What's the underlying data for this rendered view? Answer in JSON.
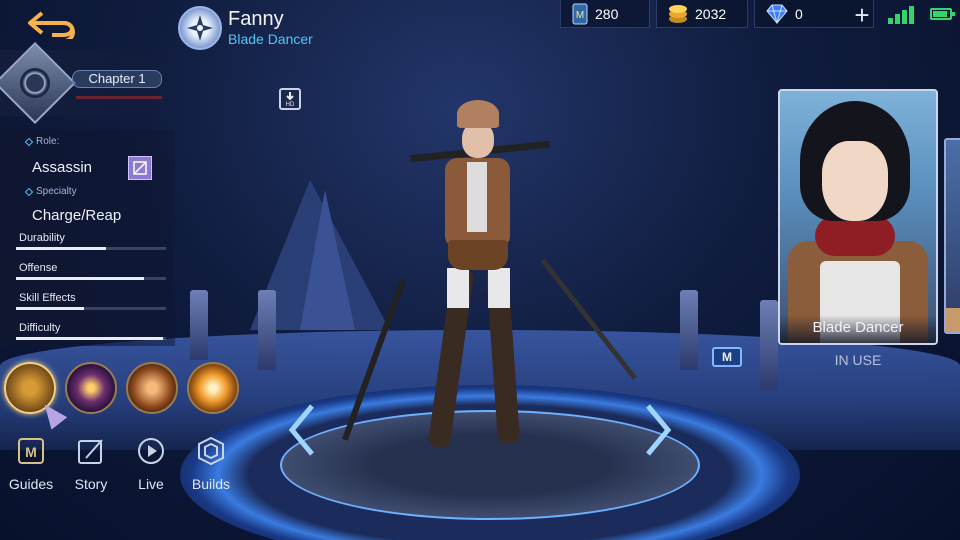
{
  "hero": {
    "name": "Fanny",
    "role_title": "Blade Dancer"
  },
  "resources": [
    {
      "icon": "ticket-icon",
      "value": "280"
    },
    {
      "icon": "gold-coin-icon",
      "value": "2032"
    },
    {
      "icon": "diamond-icon",
      "value": "0"
    }
  ],
  "chapter": {
    "label": "Chapter 1"
  },
  "attributes": {
    "role_label": "Role:",
    "role_value": "Assassin",
    "specialty_label": "Specialty",
    "specialty_value": "Charge/Reap",
    "stats": [
      {
        "label": "Durability",
        "level": 0.6
      },
      {
        "label": "Offense",
        "level": 0.85
      },
      {
        "label": "Skill Effects",
        "level": 0.45
      },
      {
        "label": "Difficulty",
        "level": 0.98
      }
    ]
  },
  "nav": [
    {
      "label": "Guides",
      "icon": "guides-book-icon"
    },
    {
      "label": "Story",
      "icon": "story-quill-icon"
    },
    {
      "label": "Live",
      "icon": "live-play-icon"
    },
    {
      "label": "Builds",
      "icon": "builds-emblem-icon"
    }
  ],
  "skin": {
    "name": "Blade Dancer",
    "status": "IN USE"
  },
  "badges": {
    "m_badge": "M"
  },
  "colors": {
    "accent_cyan": "#4fc7f2",
    "signal_green": "#33d46b",
    "role_purple": "#8d79d6"
  }
}
